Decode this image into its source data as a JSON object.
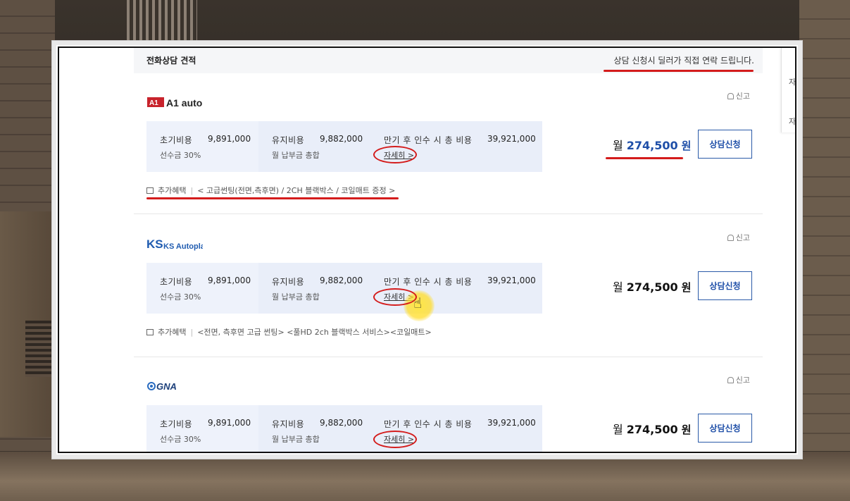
{
  "header": {
    "title": "전화상담 견적",
    "note": "상담 신청시 딜러가 직접 연락 드립니다."
  },
  "side_panel": {
    "item1": "자동",
    "item2": "자동"
  },
  "labels": {
    "initial_cost": "초기비용",
    "deposit": "선수금 30%",
    "maintenance_cost": "유지비용",
    "monthly_total": "월 납부금 총합",
    "total_at_maturity": "만기 후 인수 시 총 비용",
    "detail": "자세히",
    "report": "신고",
    "month_prefix": "월",
    "won": "원",
    "apply": "상담신청",
    "extra_benefit": "추가혜택"
  },
  "quotes": [
    {
      "dealer": "A1 auto",
      "initial_cost": "9,891,000",
      "maintenance_cost": "9,882,000",
      "total_at_maturity": "39,921,000",
      "monthly_price": "274,500",
      "benefit": "< 고급썬팅(전면,측후면) / 2CH 블랙박스 / 코일매트 증정 >"
    },
    {
      "dealer": "KS Autoplan",
      "initial_cost": "9,891,000",
      "maintenance_cost": "9,882,000",
      "total_at_maturity": "39,921,000",
      "monthly_price": "274,500",
      "benefit": "<전면, 측후면 고급 썬팅> <풀HD 2ch 블랙박스 서비스><코일매트>"
    },
    {
      "dealer": "GNA",
      "initial_cost": "9,891,000",
      "maintenance_cost": "9,882,000",
      "total_at_maturity": "39,921,000",
      "monthly_price": "274,500"
    }
  ],
  "colors": {
    "accent_blue": "#1f4fa8",
    "annotation_red": "#d41c1c",
    "cost_box_bg": "#eef2fb"
  }
}
